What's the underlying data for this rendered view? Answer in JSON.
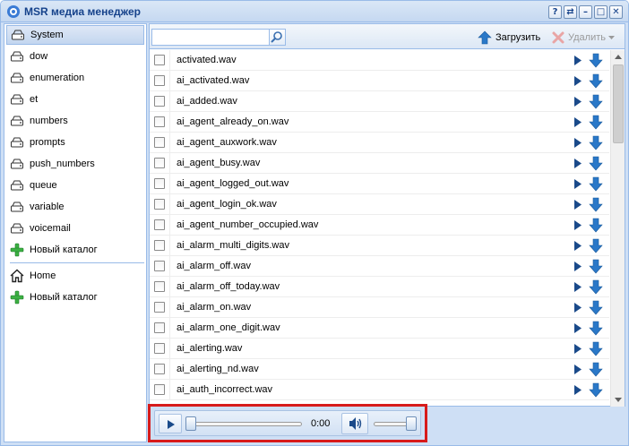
{
  "window": {
    "title": "MSR медиа менеджер",
    "buttons": [
      "?",
      "⇄",
      "–",
      "□",
      "✕"
    ]
  },
  "sidebar": {
    "items": [
      {
        "label": "System",
        "icon": "drive-icon",
        "selected": true
      },
      {
        "label": "dow",
        "icon": "drive-icon"
      },
      {
        "label": "enumeration",
        "icon": "drive-icon"
      },
      {
        "label": "et",
        "icon": "drive-icon"
      },
      {
        "label": "numbers",
        "icon": "drive-icon"
      },
      {
        "label": "prompts",
        "icon": "drive-icon"
      },
      {
        "label": "push_numbers",
        "icon": "drive-icon"
      },
      {
        "label": "queue",
        "icon": "drive-icon"
      },
      {
        "label": "variable",
        "icon": "drive-icon"
      },
      {
        "label": "voicemail",
        "icon": "drive-icon"
      },
      {
        "label": "Новый каталог",
        "icon": "add-folder-icon"
      }
    ],
    "home_items": [
      {
        "label": "Home",
        "icon": "home-icon"
      },
      {
        "label": "Новый каталог",
        "icon": "add-folder-icon"
      }
    ]
  },
  "toolbar": {
    "search_value": "",
    "upload_label": "Загрузить",
    "delete_label": "Удалить"
  },
  "files": [
    "activated.wav",
    "ai_activated.wav",
    "ai_added.wav",
    "ai_agent_already_on.wav",
    "ai_agent_auxwork.wav",
    "ai_agent_busy.wav",
    "ai_agent_logged_out.wav",
    "ai_agent_login_ok.wav",
    "ai_agent_number_occupied.wav",
    "ai_alarm_multi_digits.wav",
    "ai_alarm_off.wav",
    "ai_alarm_off_today.wav",
    "ai_alarm_on.wav",
    "ai_alarm_one_digit.wav",
    "ai_alerting.wav",
    "ai_alerting_nd.wav",
    "ai_auth_incorrect.wav"
  ],
  "player": {
    "time": "0:00",
    "progress": 0,
    "volume": 1.0
  },
  "colors": {
    "accent": "#15428b",
    "highlight": "#d71b1b",
    "download_arrow": "#2a78c8"
  }
}
